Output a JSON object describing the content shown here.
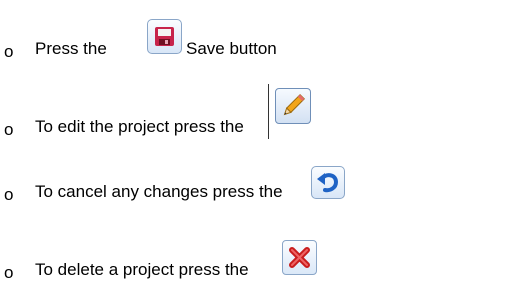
{
  "instructions": [
    {
      "bullet": "o",
      "before": "Press the",
      "after": "Save button",
      "icon": "floppy-disk-icon"
    },
    {
      "bullet": "o",
      "before": "To edit the project press the",
      "after": "",
      "icon": "pencil-icon"
    },
    {
      "bullet": "o",
      "before": "To cancel any changes press the",
      "after": "",
      "icon": "undo-arrow-icon"
    },
    {
      "bullet": "o",
      "before": "To delete a project press the",
      "after": "",
      "icon": "red-x-icon"
    }
  ],
  "colors": {
    "text": "#000000",
    "icon_border": "#8aa6c8",
    "save_red": "#c7244b",
    "undo_blue": "#1f63c5",
    "delete_red": "#c91d1d"
  }
}
